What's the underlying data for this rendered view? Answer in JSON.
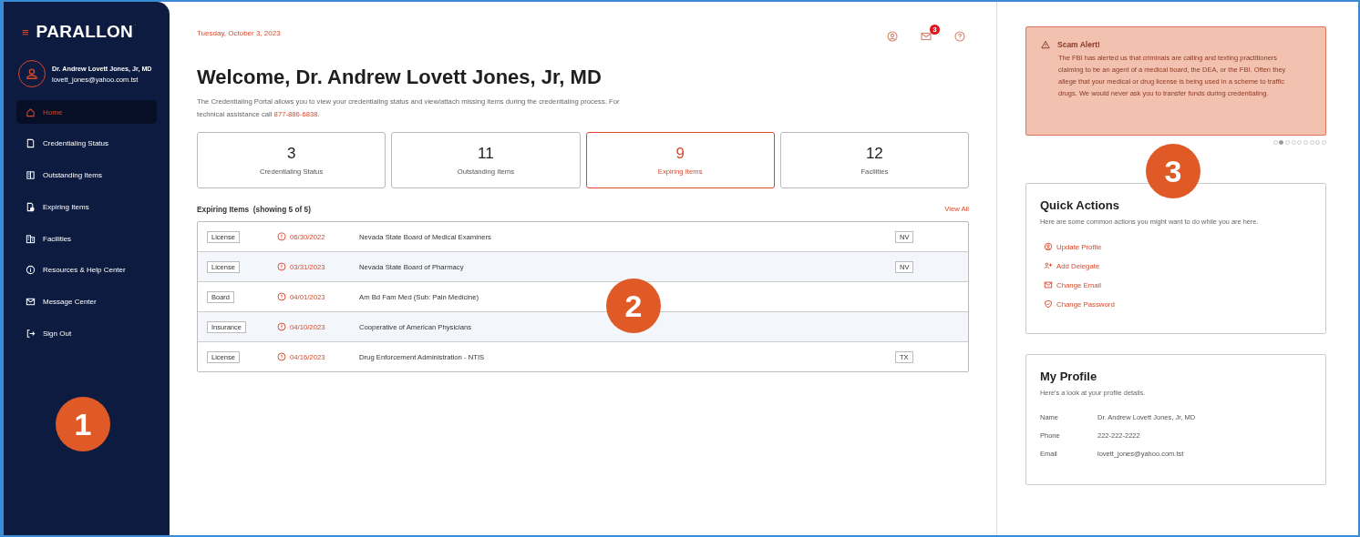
{
  "sidebar": {
    "menu_icon": "≡",
    "logo": "PARALLON",
    "logo_mark": "·",
    "user": {
      "name": "Dr. Andrew Lovett Jones, Jr, MD",
      "email": "lovett_jones@yahoo.com.tst"
    },
    "items": [
      {
        "label": "Home",
        "selected": true
      },
      {
        "label": "Credentialing Status",
        "selected": false
      },
      {
        "label": "Outstanding Items",
        "selected": false
      },
      {
        "label": "Expiring Items",
        "selected": false
      },
      {
        "label": "Facilities",
        "selected": false
      },
      {
        "label": "Resources & Help Center",
        "selected": false
      },
      {
        "label": "Message Center",
        "selected": false
      },
      {
        "label": "Sign Out",
        "selected": false
      }
    ]
  },
  "header": {
    "date": "Tuesday, October 3, 2023",
    "mail_badge": "3"
  },
  "welcome": {
    "title": "Welcome, Dr. Andrew Lovett Jones, Jr, MD",
    "description": "The Credentialing Portal allows you to view your credentialing status and view/attach missing items during the credentialing process. For technical assistance call ",
    "phone": "877-886-6838",
    "after": "."
  },
  "stats": [
    {
      "value": "3",
      "label": "Credentialing Status",
      "selected": false
    },
    {
      "value": "11",
      "label": "Outstanding Items",
      "selected": false
    },
    {
      "value": "9",
      "label": "Expiring Items",
      "selected": true
    },
    {
      "value": "12",
      "label": "Facilities",
      "selected": false
    }
  ],
  "expiring": {
    "title": "Expiring Items",
    "count": "(showing 5 of 5)",
    "view_all": "View All",
    "rows": [
      {
        "type": "License",
        "date": "06/30/2022",
        "name": "Nevada State Board of Medical Examiners",
        "state": "NV"
      },
      {
        "type": "License",
        "date": "03/31/2023",
        "name": "Nevada State Board of Pharmacy",
        "state": "NV"
      },
      {
        "type": "Board",
        "date": "04/01/2023",
        "name": "Am Bd Fam Med (Sub: Pain Medicine)"
      },
      {
        "type": "Insurance",
        "date": "04/10/2023",
        "name": "Cooperative of American Physicians"
      },
      {
        "type": "License",
        "date": "04/16/2023",
        "name": "Drug Enforcement Administration - NTIS",
        "state": "TX"
      }
    ]
  },
  "alert": {
    "title": "Scam Alert!",
    "text": "The FBI has alerted us that criminals are calling and texting practitioners claiming to be an agent of a medical board, the DEA, or the FBI. Often they allege that your medical or drug license is being used in a scheme to traffic drugs.  We would never ask you to transfer funds during credentialing."
  },
  "carousel": [
    {
      "selected": false
    },
    {
      "selected": true
    },
    {
      "selected": false
    },
    {
      "selected": false
    },
    {
      "selected": false
    },
    {
      "selected": false
    },
    {
      "selected": false
    },
    {
      "selected": false
    },
    {
      "selected": false
    }
  ],
  "quick_actions": {
    "title": "Quick Actions",
    "subtitle": "Here are some common actions you might want to do while you are here.",
    "actions": [
      "Update Profile",
      "Add Delegate",
      "Change Email",
      "Change Password"
    ]
  },
  "profile": {
    "title": "My Profile",
    "subtitle": "Here's a look at your profile details.",
    "fields": [
      {
        "label": "Name",
        "value": "Dr. Andrew Lovett Jones, Jr, MD"
      },
      {
        "label": "Phone",
        "value": "222-222-2222"
      },
      {
        "label": "Email",
        "value": "lovett_jones@yahoo.com.tst"
      }
    ]
  },
  "callouts": [
    "1",
    "2",
    "3"
  ]
}
